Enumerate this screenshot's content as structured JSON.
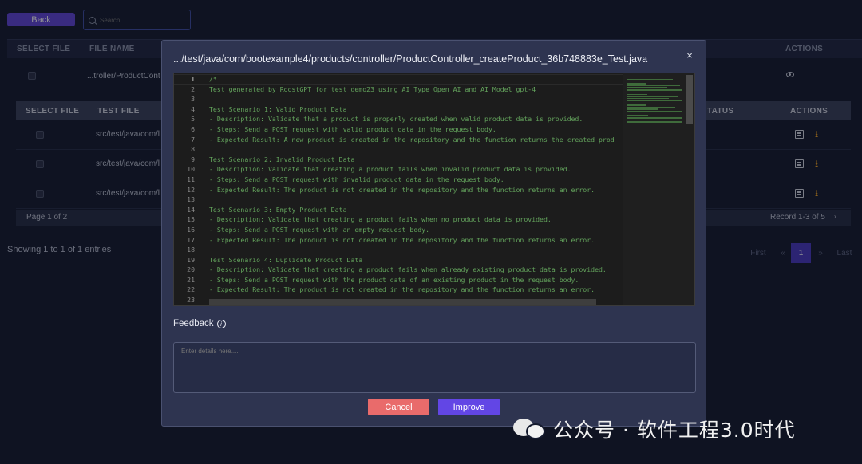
{
  "toolbar": {
    "back_label": "Back",
    "search_placeholder": "Search"
  },
  "top_table": {
    "headers": {
      "select_file": "SELECT FILE",
      "file_name": "FILE NAME",
      "actions": "ACTIONS"
    },
    "row_file": "...troller/ProductCont"
  },
  "inner_table": {
    "headers": {
      "select_file": "SELECT FILE",
      "test_file": "TEST FILE",
      "status": "TATUS",
      "actions": "ACTIONS"
    },
    "rows": [
      {
        "file": "src/test/java/com/l"
      },
      {
        "file": "src/test/java/com/l"
      },
      {
        "file": "src/test/java/com/l"
      }
    ],
    "page_text": "Page 1 of 2",
    "record_text": "Record 1-3 of 5"
  },
  "showing_text": "Showing 1 to 1 of 1 entries",
  "pagination": {
    "first": "First",
    "prev": "«",
    "current": "1",
    "next": "»",
    "last": "Last"
  },
  "modal": {
    "title": ".../test/java/com/bootexample4/products/controller/ProductController_createProduct_36b748883e_Test.java",
    "close_glyph": "×",
    "line_numbers": [
      "1",
      "2",
      "3",
      "4",
      "5",
      "6",
      "7",
      "8",
      "9",
      "10",
      "11",
      "12",
      "13",
      "14",
      "15",
      "16",
      "17",
      "18",
      "19",
      "20",
      "21",
      "22",
      "23"
    ],
    "code_lines": [
      "/*",
      "Test generated by RoostGPT for test demo23 using AI Type Open AI and AI Model gpt-4",
      "",
      "Test Scenario 1: Valid Product Data",
      "- Description: Validate that a product is properly created when valid product data is provided.",
      "- Steps: Send a POST request with valid product data in the request body.",
      "- Expected Result: A new product is created in the repository and the function returns the created prod",
      "",
      "Test Scenario 2: Invalid Product Data",
      "- Description: Validate that creating a product fails when invalid product data is provided.",
      "- Steps: Send a POST request with invalid product data in the request body.",
      "- Expected Result: The product is not created in the repository and the function returns an error.",
      "",
      "Test Scenario 3: Empty Product Data",
      "- Description: Validate that creating a product fails when no product data is provided.",
      "- Steps: Send a POST request with an empty request body.",
      "- Expected Result: The product is not created in the repository and the function returns an error.",
      "",
      "Test Scenario 4: Duplicate Product Data",
      "- Description: Validate that creating a product fails when already existing product data is provided.",
      "- Steps: Send a POST request with the product data of an existing product in the request body.",
      "- Expected Result: The product is not created in the repository and the function returns an error.",
      ""
    ],
    "feedback_label": "Feedback",
    "info_glyph": "i",
    "feedback_placeholder": "Enter details here....",
    "cancel_label": "Cancel",
    "improve_label": "Improve"
  },
  "watermark_text": "公众号 · 软件工程3.0时代",
  "colors": {
    "accent": "#6246e5",
    "cancel": "#e96b6b",
    "code_comment": "#63a35c",
    "download": "#f5a623"
  }
}
